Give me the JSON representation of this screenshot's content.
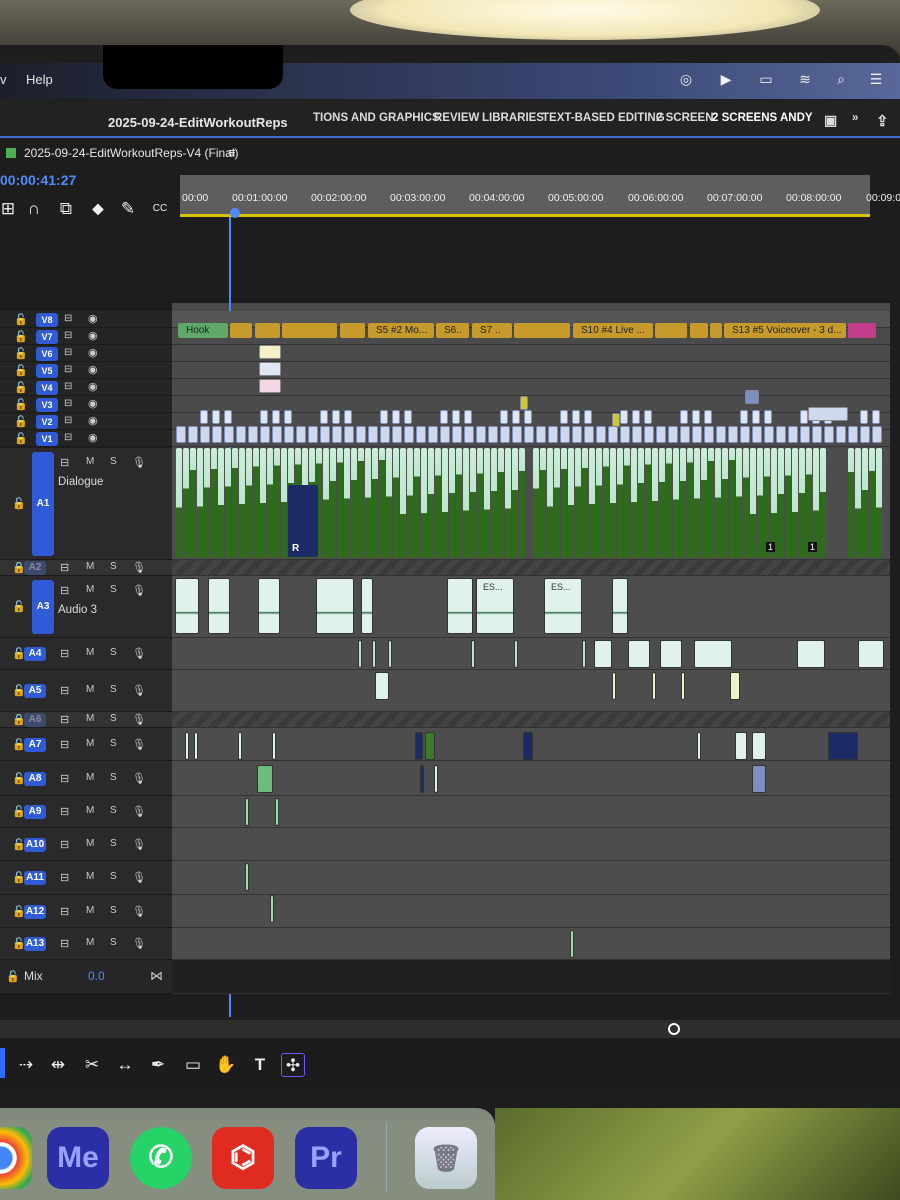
{
  "menubar": {
    "item_v": "v",
    "help": "Help"
  },
  "project_title": "2025-09-24-EditWorkoutReps",
  "workspaces": [
    "TIONS AND GRAPHICS",
    "REVIEW",
    "LIBRARIES",
    "TEXT-BASED EDITING",
    "2 SCREEN",
    "2 SCREENS ANDY"
  ],
  "sequence": {
    "name": "2025-09-24-EditWorkoutReps-V4 (Final)",
    "menu_icon": "hamburger-icon",
    "timecode": "00:00:41:27"
  },
  "ruler_ticks": [
    "00:00",
    "00:01:00:00",
    "00:02:00:00",
    "00:03:00:00",
    "00:04:00:00",
    "00:05:00:00",
    "00:06:00:00",
    "00:07:00:00",
    "00:08:00:00",
    "00:09:0"
  ],
  "video_tracks": [
    "V8",
    "V7",
    "V6",
    "V5",
    "V4",
    "V3",
    "V2",
    "V1"
  ],
  "marker_labels": [
    "Hook",
    "S5 #2 Mo...",
    "S6..",
    "S7 ..",
    "S10 #4 Live ...",
    "S13 #5 Voiceover - 3 d..."
  ],
  "audio": {
    "a1": {
      "name": "A1",
      "label": "Dialogue"
    },
    "a2": {
      "name": "A2"
    },
    "a3": {
      "name": "A3",
      "label": "Audio 3"
    },
    "rest": [
      "A4",
      "A5",
      "A6",
      "A7",
      "A8",
      "A9",
      "A10",
      "A11",
      "A12",
      "A13"
    ],
    "mix_label": "Mix",
    "mix_value": "0.0",
    "m": "M",
    "s": "S"
  },
  "clip_labels": {
    "r": "R",
    "one": "1",
    "es": "ES..."
  },
  "dock_apps": [
    {
      "name": "Chrome",
      "text": ""
    },
    {
      "name": "Media Encoder",
      "text": "Me",
      "color": "#2d2ea8"
    },
    {
      "name": "WhatsApp",
      "text": "",
      "color": "#25d366"
    },
    {
      "name": "Acrobat",
      "text": "",
      "color": "#e02b20"
    },
    {
      "name": "Premiere Pro",
      "text": "Pr",
      "color": "#2d2ea8"
    },
    {
      "name": "Trash",
      "text": ""
    }
  ]
}
